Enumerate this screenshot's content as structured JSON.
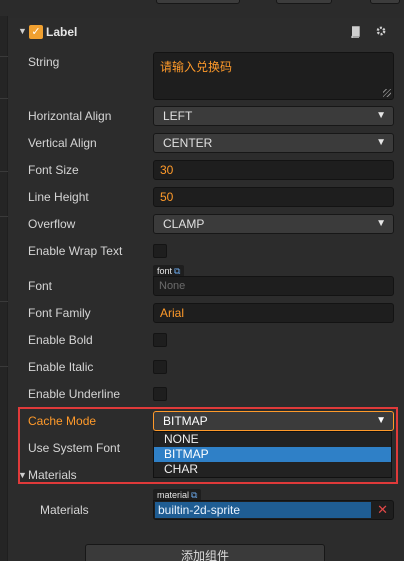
{
  "component": {
    "title": "Label",
    "enabled": true
  },
  "properties": {
    "string": {
      "label": "String",
      "value": "请输入兑换码"
    },
    "horizontal_align": {
      "label": "Horizontal Align",
      "value": "LEFT"
    },
    "vertical_align": {
      "label": "Vertical Align",
      "value": "CENTER"
    },
    "font_size": {
      "label": "Font Size",
      "value": "30"
    },
    "line_height": {
      "label": "Line Height",
      "value": "50"
    },
    "overflow": {
      "label": "Overflow",
      "value": "CLAMP"
    },
    "enable_wrap_text": {
      "label": "Enable Wrap Text",
      "checked": false
    },
    "font": {
      "label": "Font",
      "tag": "font",
      "placeholder": "None"
    },
    "font_family": {
      "label": "Font Family",
      "value": "Arial"
    },
    "enable_bold": {
      "label": "Enable Bold",
      "checked": false
    },
    "enable_italic": {
      "label": "Enable Italic",
      "checked": false
    },
    "enable_underline": {
      "label": "Enable Underline",
      "checked": false
    },
    "cache_mode": {
      "label": "Cache Mode",
      "value": "BITMAP",
      "options": [
        "NONE",
        "BITMAP",
        "CHAR"
      ],
      "selected_option": "BITMAP"
    },
    "use_system_font": {
      "label": "Use System Font"
    },
    "materials_group": {
      "label": "Materials"
    },
    "materials": {
      "label": "Materials",
      "tag": "material",
      "value": "builtin-2d-sprite"
    }
  },
  "actions": {
    "add_component": "添加组件"
  },
  "icons": {
    "collapse": "triangle-down-icon",
    "enabled_check": "checkmark-icon",
    "help": "book-icon",
    "settings": "gear-icon",
    "dropdown": "caret-down-icon",
    "asset_link": "external-link-icon",
    "clear": "close-icon"
  },
  "colors": {
    "accent_orange": "#ff9a2a",
    "selection_blue": "#2f80c7",
    "highlight_red": "#e03a3a",
    "material_blue": "#1f5d93"
  }
}
